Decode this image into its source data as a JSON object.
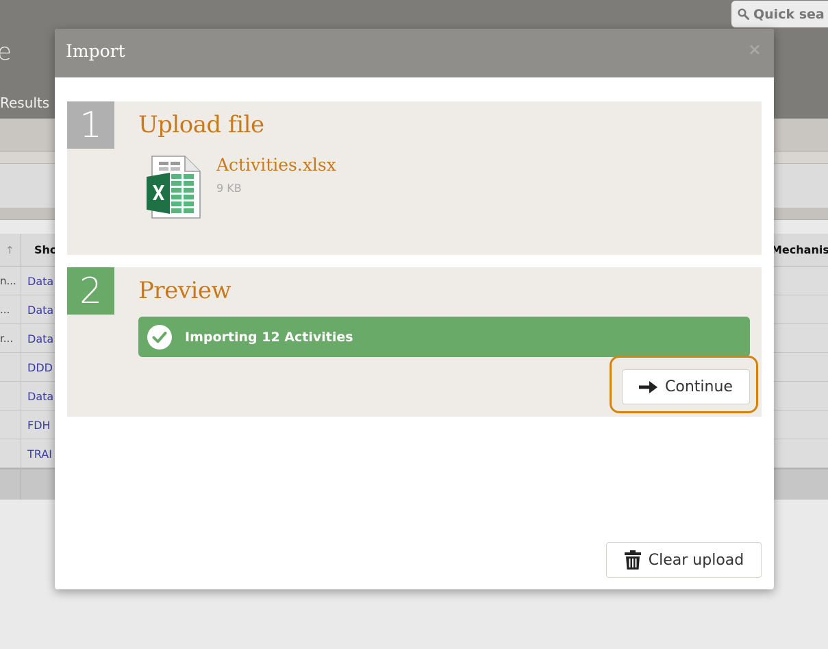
{
  "background": {
    "title_fragment": "e",
    "tab_results": "Results",
    "quick_search_placeholder": "Quick sea",
    "table": {
      "headers": {
        "short": "Sho",
        "mechanism": "Mechanisı"
      },
      "rows": [
        {
          "trunc": "n...",
          "link": "Data"
        },
        {
          "trunc": "...",
          "link": "Data"
        },
        {
          "trunc": "r...",
          "link": "Data"
        },
        {
          "trunc": "",
          "link": "DDD"
        },
        {
          "trunc": "",
          "link": "Data"
        },
        {
          "trunc": "",
          "link": "FDH"
        },
        {
          "trunc": "",
          "link": "TRAI"
        }
      ]
    }
  },
  "modal": {
    "title": "Import",
    "close_label": "×",
    "step1": {
      "number": "1",
      "title": "Upload file",
      "file_name": "Activities.xlsx",
      "file_size": "9 KB",
      "file_icon": "excel-file-icon"
    },
    "step2": {
      "number": "2",
      "title": "Preview",
      "status_text": "Importing 12 Activities",
      "continue_label": "Continue"
    },
    "clear_upload_label": "Clear upload"
  },
  "colors": {
    "accent_orange": "#c8791a",
    "highlight_orange": "#d4830f",
    "success_green": "#6aaa68",
    "header_gray": "#8f8e8a",
    "step_bg": "#efece8"
  }
}
